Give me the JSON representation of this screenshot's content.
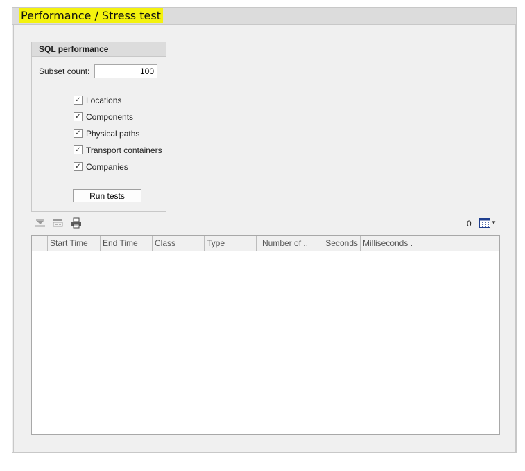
{
  "page": {
    "title": "Performance / Stress test"
  },
  "sql_group": {
    "header": "SQL performance",
    "subset_label": "Subset count:",
    "subset_value": "100",
    "checkboxes": [
      {
        "label": "Locations",
        "checked": true
      },
      {
        "label": "Components",
        "checked": true
      },
      {
        "label": "Physical paths",
        "checked": true
      },
      {
        "label": "Transport containers",
        "checked": true
      },
      {
        "label": "Companies",
        "checked": true
      }
    ],
    "run_button": "Run tests"
  },
  "toolbar": {
    "icons": [
      "filter-clear-icon",
      "column-chooser-icon",
      "print-icon",
      "grid-layout-icon"
    ],
    "row_count": "0"
  },
  "table": {
    "columns": [
      "",
      "Start Time",
      "End Time",
      "Class",
      "Type",
      "Number of ...",
      "Seconds",
      "Milliseconds ..."
    ],
    "rows": []
  }
}
